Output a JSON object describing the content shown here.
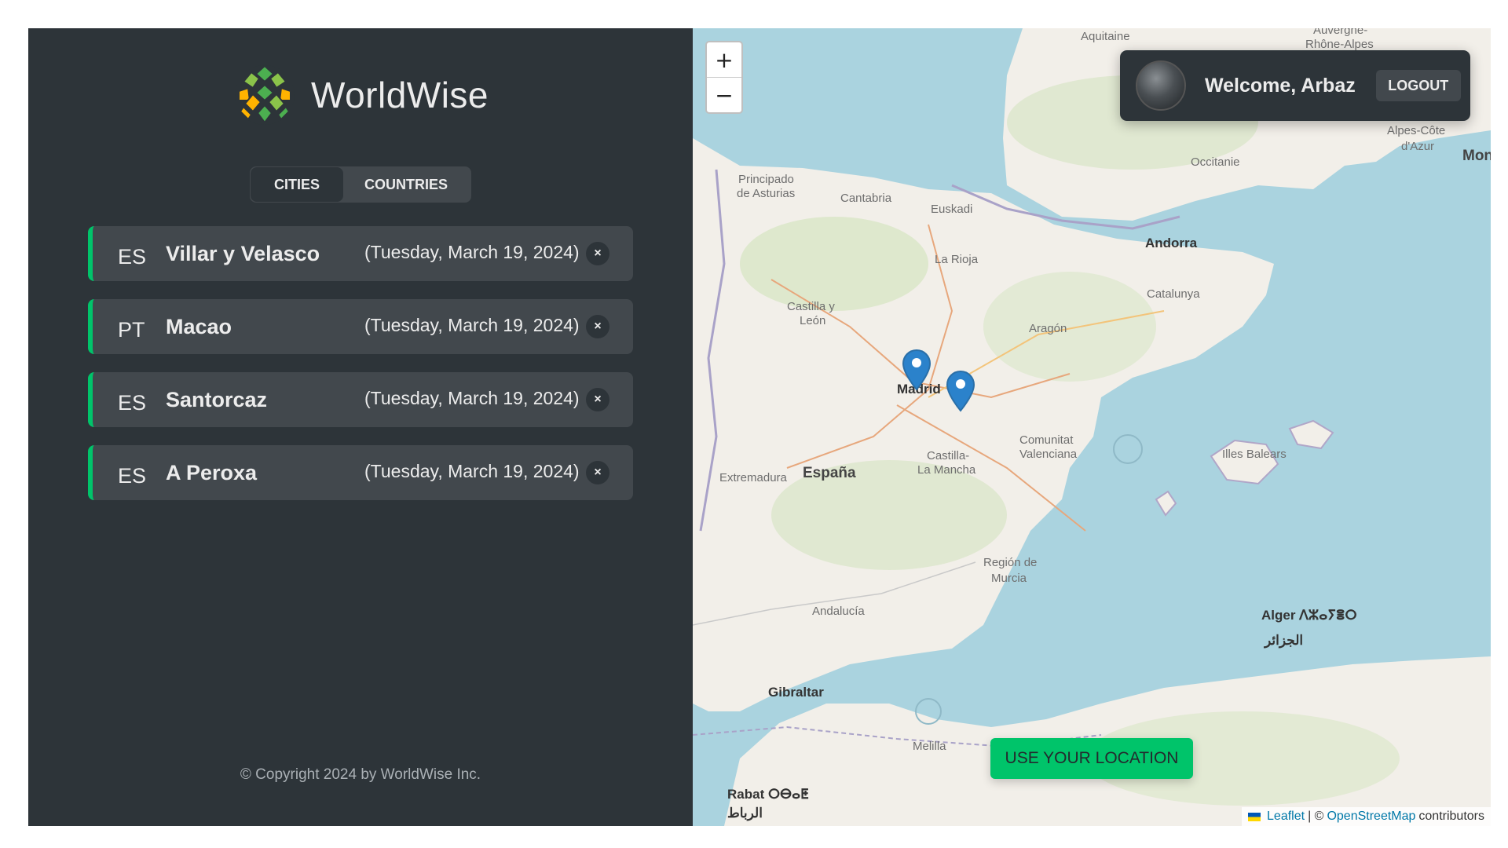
{
  "brand": {
    "name": "WorldWise"
  },
  "tabs": [
    {
      "label": "CITIES",
      "active": true
    },
    {
      "label": "COUNTRIES",
      "active": false
    }
  ],
  "cities": [
    {
      "code": "ES",
      "name": "Villar y Velasco",
      "date": "(Tuesday, March 19, 2024)"
    },
    {
      "code": "PT",
      "name": "Macao",
      "date": "(Tuesday, March 19, 2024)"
    },
    {
      "code": "ES",
      "name": "Santorcaz",
      "date": "(Tuesday, March 19, 2024)"
    },
    {
      "code": "ES",
      "name": "A Peroxa",
      "date": "(Tuesday, March 19, 2024)"
    }
  ],
  "delete_symbol": "×",
  "footer": {
    "copyright": "© Copyright 2024 by WorldWise Inc."
  },
  "map": {
    "zoom_in": "+",
    "zoom_out": "−",
    "labels": {
      "aquitaine": "Aquitaine",
      "auvergne": "Auvergne-",
      "rhone_alpes": "Rhône-Alpes",
      "alpes_cote": "Alpes-Côte",
      "dazur": "d'Azur",
      "mon": "Mon",
      "occitanie": "Occitanie",
      "principado": "Principado",
      "de_asturias": "de Asturias",
      "cantabria": "Cantabria",
      "euskadi": "Euskadi",
      "andorra": "Andorra",
      "la_rioja": "La Rioja",
      "catalunya": "Catalunya",
      "castilla_leon_1": "Castilla y",
      "castilla_leon_2": "León",
      "aragon": "Aragón",
      "madrid": "Madrid",
      "comunitat_1": "Comunitat",
      "comunitat_2": "Valenciana",
      "illes_balears": "Illes Balears",
      "castilla_mancha_1": "Castilla-",
      "castilla_mancha_2": "La Mancha",
      "extremadura": "Extremadura",
      "espana": "España",
      "region_murcia_1": "Región de",
      "region_murcia_2": "Murcia",
      "andalucia": "Andalucía",
      "alger": "Alger ⴷⵣⴰⵢⴻⵔ",
      "aljazair": "الجزائر",
      "gibraltar": "Gibraltar",
      "melilla": "Melilla",
      "rabat": "Rabat ⵔⴱⴰⵟ",
      "rabat_ar": "الرباط"
    },
    "markers": [
      {
        "name": "marker-santorcaz"
      },
      {
        "name": "marker-villar-y-velasco"
      }
    ]
  },
  "user": {
    "welcome": "Welcome, Arbaz",
    "logout_label": "LOGOUT"
  },
  "location_button": {
    "label": "USE YOUR LOCATION"
  },
  "attribution": {
    "leaflet": "Leaflet",
    "separator": "| ©",
    "osm": "OpenStreetMap",
    "contributors": "contributors"
  },
  "colors": {
    "sidebar_bg": "#2d3439",
    "item_bg": "#42484d",
    "accent_green": "#00c46a",
    "sea": "#aad3df",
    "land": "#f2efe9"
  }
}
